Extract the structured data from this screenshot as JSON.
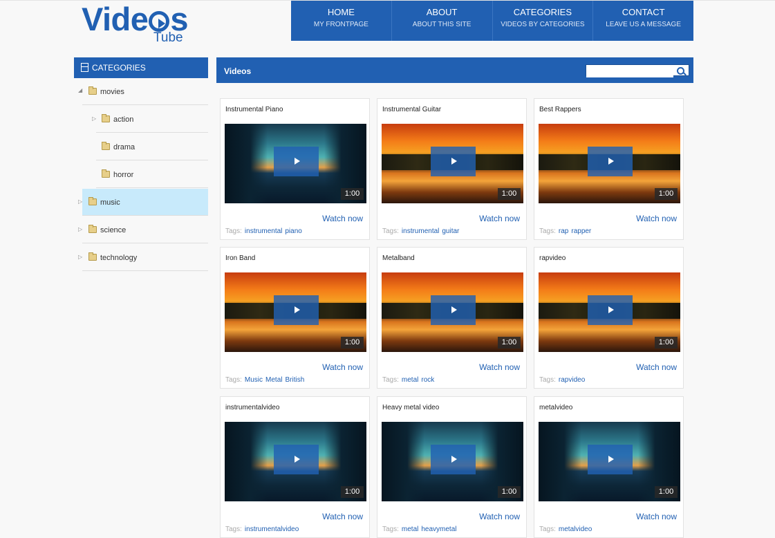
{
  "logo": {
    "text_before": "Vide",
    "text_after": "s",
    "sub": "Tube"
  },
  "nav": [
    {
      "title": "HOME",
      "sub": "MY FRONTPAGE"
    },
    {
      "title": "ABOUT",
      "sub": "ABOUT THIS SITE"
    },
    {
      "title": "CATEGORIES",
      "sub": "VIDEOS BY CATEGORIES"
    },
    {
      "title": "CONTACT",
      "sub": "LEAVE US A MESSAGE"
    }
  ],
  "sidebar": {
    "title": "CATEGORIES",
    "items": [
      {
        "label": "movies",
        "expanded": true,
        "level": 0
      },
      {
        "label": "action",
        "expanded": false,
        "level": 1
      },
      {
        "label": "drama",
        "level": 1
      },
      {
        "label": "horror",
        "level": 1
      },
      {
        "label": "music",
        "selected": true,
        "level": 0
      },
      {
        "label": "science",
        "level": 0
      },
      {
        "label": "technology",
        "level": 0
      }
    ]
  },
  "videos_panel": {
    "title": "Videos",
    "search_placeholder": ""
  },
  "labels": {
    "watch": "Watch now",
    "tags": "Tags:"
  },
  "videos": [
    {
      "title": "Instrumental Piano",
      "duration": "1:00",
      "thumb": "forest",
      "tags": [
        "instrumental",
        "piano"
      ]
    },
    {
      "title": "Instrumental Guitar",
      "duration": "1:00",
      "thumb": "sunset",
      "tags": [
        "instrumental",
        "guitar"
      ]
    },
    {
      "title": "Best Rappers",
      "duration": "1:00",
      "thumb": "sunset",
      "tags": [
        "rap",
        "rapper"
      ]
    },
    {
      "title": "Iron Band",
      "duration": "1:00",
      "thumb": "sunset",
      "tags": [
        "Music",
        "Metal",
        "British"
      ]
    },
    {
      "title": "Metalband",
      "duration": "1:00",
      "thumb": "sunset",
      "tags": [
        "metal",
        "rock"
      ]
    },
    {
      "title": "rapvideo",
      "duration": "1:00",
      "thumb": "sunset",
      "tags": [
        "rapvideo"
      ]
    },
    {
      "title": "instrumentalvideo",
      "duration": "1:00",
      "thumb": "forest",
      "tags": [
        "instrumentalvideo"
      ]
    },
    {
      "title": "Heavy metal video",
      "duration": "1:00",
      "thumb": "forest",
      "tags": [
        "metal",
        "heavymetal"
      ]
    },
    {
      "title": "metalvideo",
      "duration": "1:00",
      "thumb": "forest",
      "tags": [
        "metalvideo"
      ]
    }
  ],
  "colors": {
    "brand": "#2160b2",
    "selected_row": "#c8eafb",
    "page_bg": "#f8f8f8"
  }
}
